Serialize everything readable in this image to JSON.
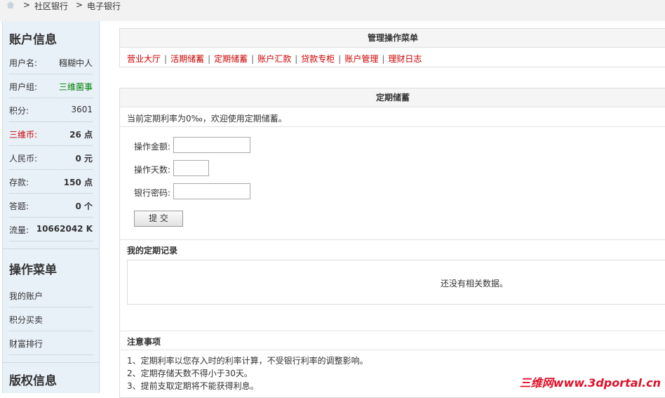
{
  "breadcrumb": {
    "items": [
      "社区银行",
      "电子银行"
    ],
    "separator": ">"
  },
  "sidebar": {
    "account_title": "账户信息",
    "rows": [
      {
        "key": "用户名:",
        "value": "糨糊中人"
      },
      {
        "key": "用户组:",
        "value": "三维菌事"
      },
      {
        "key": "积分:",
        "value": "3601"
      },
      {
        "key": "三维币:",
        "value": "26 点"
      },
      {
        "key": "人民币:",
        "value": "0 元"
      },
      {
        "key": "存款:",
        "value": "150 点"
      },
      {
        "key": "答题:",
        "value": "0 个"
      },
      {
        "key": "流量:",
        "value": "10662042 K"
      }
    ],
    "menu_title": "操作菜单",
    "menu": [
      "我的账户",
      "积分买卖",
      "财富排行"
    ],
    "copyright_title": "版权信息"
  },
  "manage": {
    "title": "管理操作菜单",
    "links": [
      "营业大厅",
      "活期储蓄",
      "定期储蓄",
      "账户汇款",
      "贷款专柜",
      "账户管理",
      "理财日志"
    ]
  },
  "fixed": {
    "title": "定期储蓄",
    "intro": "当前定期利率为0‰，欢迎使用定期储蓄。",
    "amount_label": "操作金额:",
    "days_label": "操作天数:",
    "password_label": "银行密码:",
    "submit": "提 交",
    "records_title": "我的定期记录",
    "empty": "还没有相关数据。",
    "notes_title": "注意事项",
    "notes": [
      "1、定期利率以您存入时的利率计算，不受银行利率的调整影响。",
      "2、定期存储天数不得小于30天。",
      "3、提前支取定期将不能获得利息。"
    ]
  },
  "watermark": "三维网www.3dportal.cn",
  "colors": {
    "link_red": "#cc0000",
    "group_green": "#008000",
    "coin_red": "#cc0000"
  }
}
